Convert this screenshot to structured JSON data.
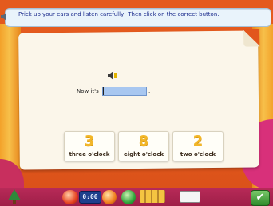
{
  "instruction": "Prick up your ears and listen carefully! Then click on the correct button.",
  "question": {
    "prefix": "Now it's",
    "answer_value": "",
    "suffix": "."
  },
  "choices": [
    {
      "number": "3",
      "label": "three o'clock"
    },
    {
      "number": "8",
      "label": "eight o'clock"
    },
    {
      "number": "2",
      "label": "two o'clock"
    }
  ],
  "toolbar": {
    "clock_text": "0:00",
    "check_symbol": "✔"
  },
  "icons": {
    "top_speaker": "speaker-icon",
    "sound_button": "speaker-icon",
    "tree": "tree-icon",
    "confirm": "check-icon"
  },
  "colors": {
    "background": "#e2561c",
    "number_color": "#f2b628",
    "instruction_text": "#1a2a8c",
    "answer_box": "#a8c7f0",
    "toolbar": "#b82a58"
  }
}
